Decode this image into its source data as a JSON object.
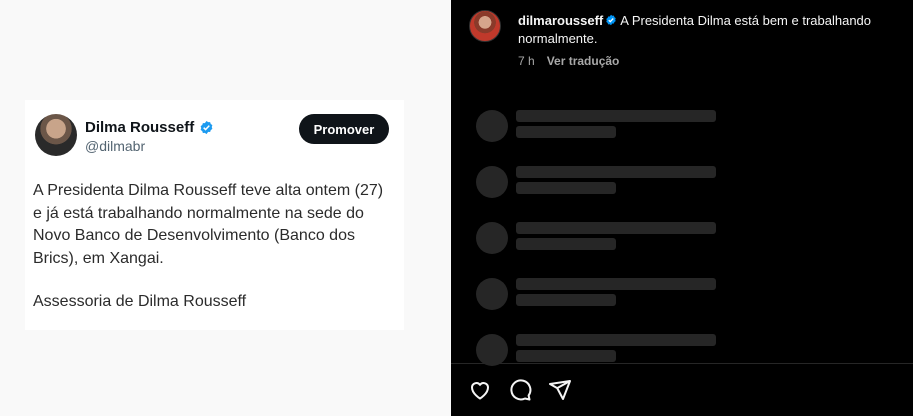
{
  "tweet": {
    "author_name": "Dilma Rousseff",
    "handle": "@dilmabr",
    "promote_label": "Promover",
    "body": "A Presidenta Dilma Rousseff teve alta ontem (27) e já está trabalhando normalmente na sede do Novo Banco de Desenvolvimento (Banco dos Brics), em Xangai.",
    "signature": "Assessoria de Dilma Rousseff",
    "verified_color": "#1d9bf0"
  },
  "post": {
    "username": "dilmarousseff",
    "caption": "A Presidenta Dilma está bem e trabalhando normalmente.",
    "time_ago": "7 h",
    "translate_label": "Ver tradução",
    "verified_color": "#0095f6"
  },
  "comments_loading_placeholders": 5,
  "actions": {
    "icons": [
      "heart-icon",
      "comment-icon",
      "share-icon"
    ]
  }
}
